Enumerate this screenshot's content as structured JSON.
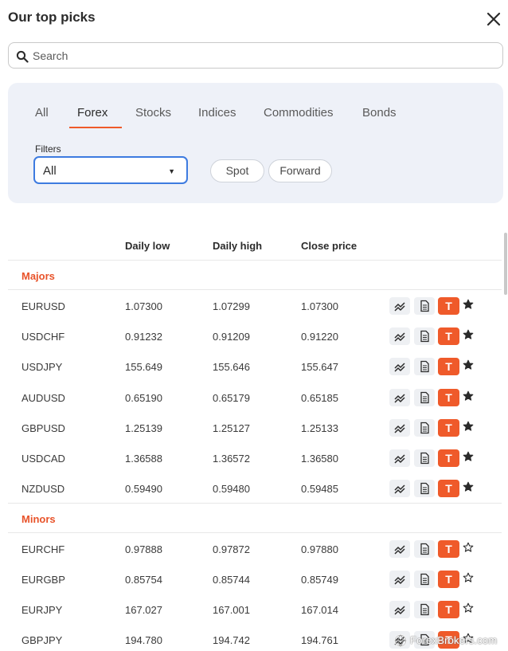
{
  "header": {
    "title": "Our top picks"
  },
  "search": {
    "placeholder": "Search"
  },
  "tabs": [
    "All",
    "Forex",
    "Stocks",
    "Indices",
    "Commodities",
    "Bonds"
  ],
  "active_tab": "Forex",
  "filters": {
    "label": "Filters",
    "selected": "All",
    "options": [
      "Spot",
      "Forward"
    ]
  },
  "table": {
    "columns": [
      "Daily low",
      "Daily high",
      "Close price"
    ],
    "groups": [
      {
        "name": "Majors",
        "rows": [
          {
            "symbol": "EURUSD",
            "daily_low": "1.07300",
            "daily_high": "1.07299",
            "close": "1.07300",
            "starred": true
          },
          {
            "symbol": "USDCHF",
            "daily_low": "0.91232",
            "daily_high": "0.91209",
            "close": "0.91220",
            "starred": true
          },
          {
            "symbol": "USDJPY",
            "daily_low": "155.649",
            "daily_high": "155.646",
            "close": "155.647",
            "starred": true
          },
          {
            "symbol": "AUDUSD",
            "daily_low": "0.65190",
            "daily_high": "0.65179",
            "close": "0.65185",
            "starred": true
          },
          {
            "symbol": "GBPUSD",
            "daily_low": "1.25139",
            "daily_high": "1.25127",
            "close": "1.25133",
            "starred": true
          },
          {
            "symbol": "USDCAD",
            "daily_low": "1.36588",
            "daily_high": "1.36572",
            "close": "1.36580",
            "starred": true
          },
          {
            "symbol": "NZDUSD",
            "daily_low": "0.59490",
            "daily_high": "0.59480",
            "close": "0.59485",
            "starred": true
          }
        ]
      },
      {
        "name": "Minors",
        "rows": [
          {
            "symbol": "EURCHF",
            "daily_low": "0.97888",
            "daily_high": "0.97872",
            "close": "0.97880",
            "starred": false
          },
          {
            "symbol": "EURGBP",
            "daily_low": "0.85754",
            "daily_high": "0.85744",
            "close": "0.85749",
            "starred": false
          },
          {
            "symbol": "EURJPY",
            "daily_low": "167.027",
            "daily_high": "167.001",
            "close": "167.014",
            "starred": false
          },
          {
            "symbol": "GBPJPY",
            "daily_low": "194.780",
            "daily_high": "194.742",
            "close": "194.761",
            "starred": false
          }
        ]
      }
    ]
  },
  "trade_button_label": "T",
  "watermark": "ForexBrokers.com",
  "colors": {
    "accent": "#ef5a2a",
    "group_heading": "#e8532a",
    "focus": "#3d7be0",
    "panel_bg": "#eef1f8"
  },
  "icons": {
    "close": "close-icon",
    "search": "search-icon",
    "chart": "chart-icon",
    "doc": "document-icon",
    "star": "star-icon",
    "caret": "caret-down-icon"
  }
}
